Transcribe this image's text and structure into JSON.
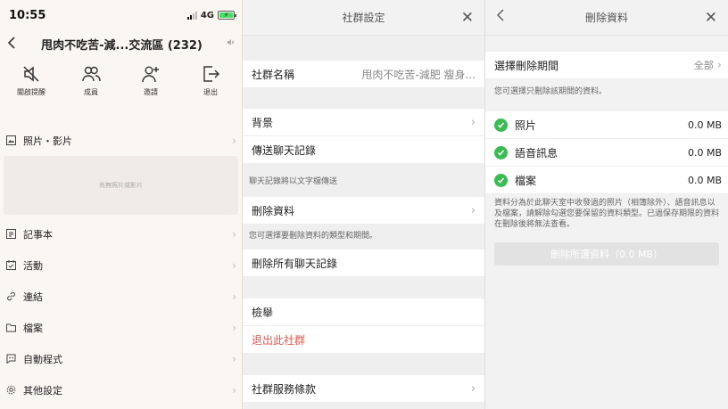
{
  "status": {
    "time": "10:55",
    "network": "4G"
  },
  "chat": {
    "title": "甩肉不吃苦-減...交流區 (232)",
    "actions": [
      {
        "icon": "mute-icon",
        "label": "關啟提醒"
      },
      {
        "icon": "members-icon",
        "label": "成員"
      },
      {
        "icon": "invite-icon",
        "label": "邀請"
      },
      {
        "icon": "exit-icon",
        "label": "退出"
      }
    ],
    "photos_label": "照片・影片",
    "photos_empty": "尚無照片或影片",
    "menu": [
      {
        "icon": "note-icon",
        "label": "記事本"
      },
      {
        "icon": "calendar-icon",
        "label": "活動"
      },
      {
        "icon": "link-icon",
        "label": "連結"
      },
      {
        "icon": "folder-icon",
        "label": "檔案"
      },
      {
        "icon": "bot-icon",
        "label": "自動程式"
      },
      {
        "icon": "gear-icon",
        "label": "其他設定"
      }
    ]
  },
  "settings": {
    "title": "社群設定",
    "name_label": "社群名稱",
    "name_value": "甩肉不吃苦-減肥 瘦身...",
    "background_label": "背景",
    "export_label": "傳送聊天記錄",
    "export_note": "聊天記錄將以文字檔傳送",
    "delete_label": "刪除資料",
    "delete_note": "您可選擇要刪除資料的類型和期間。",
    "delete_all_label": "刪除所有聊天記錄",
    "report_label": "檢舉",
    "leave_label": "退出此社群",
    "terms_label": "社群服務條款"
  },
  "delete": {
    "title": "刪除資料",
    "period_label": "選擇刪除期間",
    "period_value": "全部",
    "period_note": "您可選擇只刪除該期間的資料。",
    "items": [
      {
        "label": "照片",
        "size": "0.0 MB"
      },
      {
        "label": "語音訊息",
        "size": "0.0 MB"
      },
      {
        "label": "檔案",
        "size": "0.0 MB"
      }
    ],
    "description": "資料分為於此聊天室中收發過的照片（相簿除外）、語音訊息以及檔案，請解除勾選您要保留的資料類型。已過保存期限的資料在刪除後將無法查看。",
    "button_label": "刪除所選資料（0.0 MB）"
  },
  "colors": {
    "check": "#3cba54",
    "danger": "#e0564f",
    "battery": "#4cd964"
  }
}
